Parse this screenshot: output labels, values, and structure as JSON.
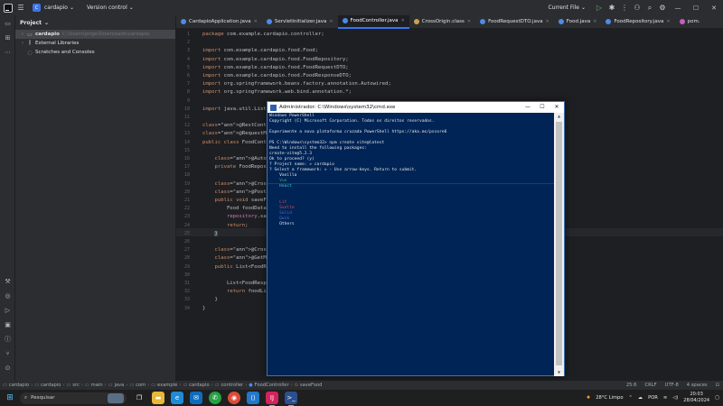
{
  "titlebar": {
    "project_badge": "C",
    "project_name": "cardapio",
    "vcs": "Version control",
    "run_config": "Current File"
  },
  "project_panel": {
    "title": "Project",
    "tree": [
      {
        "arrow": "›",
        "name": "cardapio",
        "path": "C:\\Users\\jorge\\Downloads\\cardapio",
        "selected": true
      },
      {
        "arrow": "›",
        "name": "External Libraries",
        "path": "",
        "selected": false
      },
      {
        "arrow": "",
        "name": "Scratches and Consoles",
        "path": "",
        "selected": false
      }
    ]
  },
  "tabs": [
    {
      "label": "CardapioApplication.java",
      "color": "#4d8be8",
      "active": false
    },
    {
      "label": "ServletInitializer.java",
      "color": "#4d8be8",
      "active": false
    },
    {
      "label": "FoodController.java",
      "color": "#4d8be8",
      "active": true
    },
    {
      "label": "CrossOrigin.class",
      "color": "#c9a34e",
      "active": false
    },
    {
      "label": "FoodRequestDTO.java",
      "color": "#4d8be8",
      "active": false
    },
    {
      "label": "Food.java",
      "color": "#4d8be8",
      "active": false
    },
    {
      "label": "FoodRepository.java",
      "color": "#4d8be8",
      "active": false
    },
    {
      "label": "pom.",
      "color": "#c45ec4",
      "active": false
    }
  ],
  "editor": {
    "lines": [
      {
        "n": "1",
        "code": "package com.example.cardapio.controller;"
      },
      {
        "n": "2",
        "code": ""
      },
      {
        "n": "3",
        "code": "import com.example.cardapio.food.Food;"
      },
      {
        "n": "4",
        "code": "import com.example.cardapio.food.FoodRepository;"
      },
      {
        "n": "5",
        "code": "import com.example.cardapio.food.FoodRequestDTO;"
      },
      {
        "n": "6",
        "code": "import com.example.cardapio.food.FoodResponseDTO;"
      },
      {
        "n": "7",
        "code": "import org.springframework.beans.factory.annotation.Autowired;"
      },
      {
        "n": "8",
        "code": "import org.springframework.web.bind.annotation.*;"
      },
      {
        "n": "9",
        "code": ""
      },
      {
        "n": "10",
        "code": "import java.util.List"
      },
      {
        "n": "11",
        "code": ""
      },
      {
        "n": "12",
        "code": "@RestController  no usa"
      },
      {
        "n": "13",
        "code": "@RequestMapping(\"food"
      },
      {
        "n": "14",
        "code": "public class FoodCont"
      },
      {
        "n": "15",
        "code": ""
      },
      {
        "n": "16",
        "code": "    @Autowired  1 usage"
      },
      {
        "n": "17",
        "code": "    private FoodRepos"
      },
      {
        "n": "18",
        "code": ""
      },
      {
        "n": "19",
        "code": "    @CrossOrigin(orig"
      },
      {
        "n": "20",
        "code": "    @PostMapping"
      },
      {
        "n": "21",
        "code": "    public void saveF"
      },
      {
        "n": "22",
        "code": "        Food foodData"
      },
      {
        "n": "23",
        "code": "        repository.sa"
      },
      {
        "n": "24",
        "code": "        return;"
      },
      {
        "n": "25",
        "code": "    }"
      },
      {
        "n": "26",
        "code": ""
      },
      {
        "n": "27",
        "code": "    @CrossOrigin(orig"
      },
      {
        "n": "28",
        "code": "    @GetMapping"
      },
      {
        "n": "29",
        "code": "    public List<FoodR"
      },
      {
        "n": "30",
        "code": ""
      },
      {
        "n": "31",
        "code": "        List<FoodResp"
      },
      {
        "n": "32",
        "code": "        return foodLi"
      },
      {
        "n": "33",
        "code": "    }"
      },
      {
        "n": "34",
        "code": "}"
      }
    ]
  },
  "terminal": {
    "title": "Administrador: C:\\Windows\\system32\\cmd.exe",
    "lines": [
      "Windows PowerShell",
      "Copyright (C) Microsoft Corporation. Todos os direitos reservados.",
      "",
      "Experimente a nova plataforma cruzada PowerShell https://aka.ms/pscore6",
      "",
      "PS C:\\Windows\\system32> npm create vite@latest",
      "Need to install the following packages:",
      "create-vite@5.2.3",
      "Ok to proceed? (y)",
      "? Project name: » cardapio",
      "? Select a framework: » - Use arrow-keys. Return to submit.",
      "    Vanilla",
      "    Vue",
      "    React",
      "",
      "",
      "    Lit",
      "    Svelte",
      "    Solid",
      "    Qwik",
      "    Others"
    ]
  },
  "statusbar": {
    "crumbs": [
      "cardapio",
      "cardapio",
      "src",
      "main",
      "java",
      "com",
      "example",
      "cardapio",
      "controller",
      "FoodController",
      "saveFood"
    ],
    "position": "25:6",
    "line_sep": "CRLF",
    "encoding": "UTF-8",
    "indent": "4 spaces"
  },
  "taskbar": {
    "search_placeholder": "Pesquisar",
    "weather": "28°C  Limpo",
    "language": "POR",
    "time": "20:03",
    "date": "28/04/2024"
  }
}
